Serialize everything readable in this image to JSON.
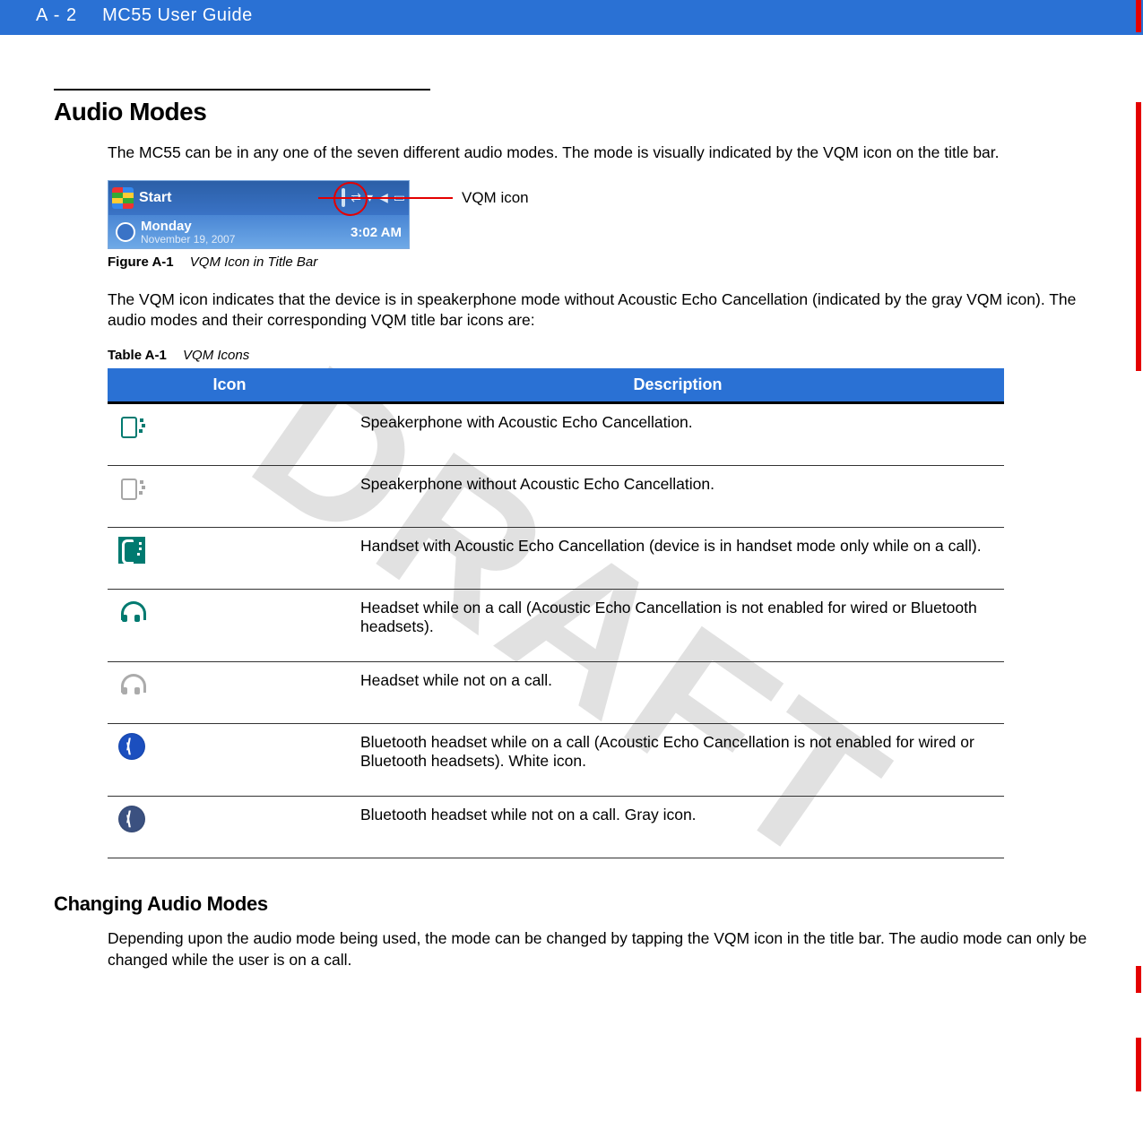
{
  "header": {
    "page_number": "A - 2",
    "guide_title": "MC55 User Guide"
  },
  "watermark": "DRAFT",
  "section1": {
    "title": "Audio Modes",
    "intro": "The MC55 can be in any one of the seven different audio modes. The mode is visually indicated by the VQM icon on the title bar.",
    "after_figure": "The VQM icon indicates that the device is in speakerphone mode without Acoustic Echo Cancellation (indicated by the gray VQM icon). The audio modes and their corresponding VQM title bar icons are:"
  },
  "figure": {
    "start_text": "Start",
    "day": "Monday",
    "date": "November 19, 2007",
    "time": "3:02 AM",
    "callout": "VQM icon",
    "caption_label": "Figure A-1",
    "caption_text": "VQM Icon in Title Bar"
  },
  "table": {
    "caption_label": "Table A-1",
    "caption_text": "VQM Icons",
    "headers": {
      "icon": "Icon",
      "desc": "Description"
    },
    "rows": [
      {
        "icon_name": "speakerphone-aec-icon",
        "desc": "Speakerphone with Acoustic Echo Cancellation."
      },
      {
        "icon_name": "speakerphone-noaec-icon",
        "desc": "Speakerphone without Acoustic Echo Cancellation."
      },
      {
        "icon_name": "handset-aec-icon",
        "desc": "Handset with Acoustic Echo Cancellation (device is in handset mode only while on a call)."
      },
      {
        "icon_name": "headset-oncall-icon",
        "desc": "Headset while on a call (Acoustic Echo Cancellation is not enabled for wired or Bluetooth headsets)."
      },
      {
        "icon_name": "headset-idle-icon",
        "desc": " Headset while not on a call."
      },
      {
        "icon_name": "bt-headset-oncall-icon",
        "desc": "Bluetooth headset while on a call (Acoustic Echo Cancellation is not enabled for wired or Bluetooth headsets). White icon."
      },
      {
        "icon_name": "bt-headset-idle-icon",
        "desc": "Bluetooth headset while not on a call. Gray icon."
      }
    ]
  },
  "section2": {
    "title": "Changing Audio Modes",
    "body": "Depending upon the audio mode being used, the mode can be changed by tapping the VQM icon in the title bar. The audio mode can only be changed while the user is on a call."
  }
}
